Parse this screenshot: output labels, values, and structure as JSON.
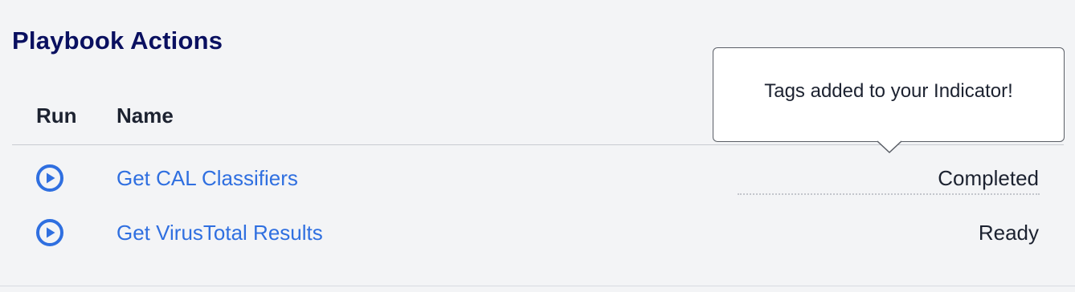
{
  "page": {
    "title": "Playbook Actions"
  },
  "table": {
    "columns": {
      "run": "Run",
      "name": "Name"
    },
    "rows": [
      {
        "name": "Get CAL Classifiers",
        "status": "Completed",
        "run_icon": "play-circle-icon"
      },
      {
        "name": "Get VirusTotal Results",
        "status": "Ready",
        "run_icon": "play-circle-icon"
      }
    ]
  },
  "tooltip": {
    "text": "Tags added to your Indicator!"
  },
  "colors": {
    "title": "#0a1060",
    "link": "#2f6fe0",
    "icon": "#2f6fe0",
    "background": "#f3f4f6"
  }
}
